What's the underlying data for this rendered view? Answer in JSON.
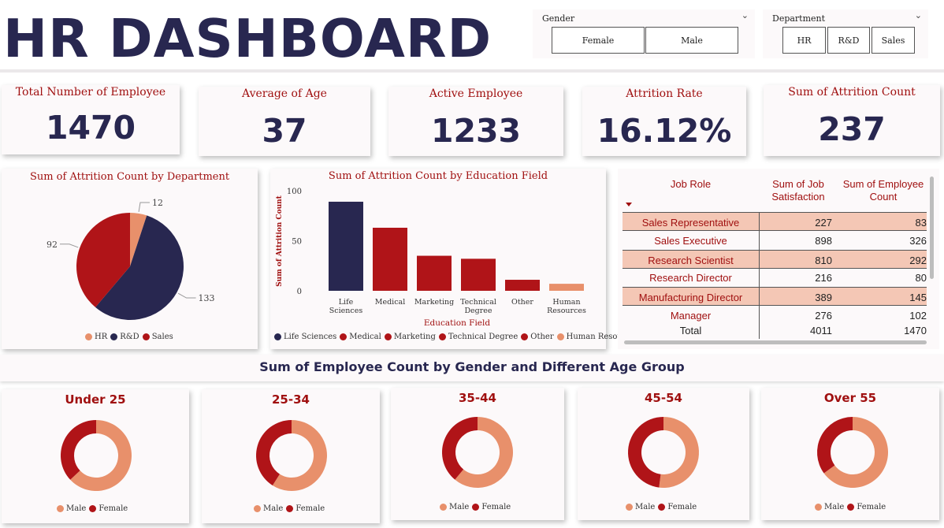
{
  "header": {
    "title": "HR DASHBOARD"
  },
  "slicers": {
    "gender": {
      "label": "Gender",
      "options": [
        "Female",
        "Male"
      ]
    },
    "department": {
      "label": "Department",
      "options": [
        "HR",
        "R&D",
        "Sales"
      ]
    }
  },
  "kpis": [
    {
      "label": "Total Number of Employee",
      "value": "1470"
    },
    {
      "label": "Average of Age",
      "value": "37"
    },
    {
      "label": "Active Employee",
      "value": "1233"
    },
    {
      "label": "Attrition Rate",
      "value": "16.12%"
    },
    {
      "label": "Sum of Attrition Count",
      "value": "237"
    }
  ],
  "colors": {
    "navy": "#282750",
    "red": "#b01418",
    "peach": "#e8906b",
    "table_band": "#f4c7b5",
    "title": "#282750",
    "accent_text": "#a01010"
  },
  "chart_data": [
    {
      "type": "pie",
      "title": "Sum of Attrition Count by Department",
      "categories": [
        "HR",
        "R&D",
        "Sales"
      ],
      "values": [
        12,
        133,
        92
      ],
      "colors": [
        "#e8906b",
        "#282750",
        "#b01418"
      ],
      "legend": "bottom"
    },
    {
      "type": "bar",
      "title": "Sum of Attrition Count by Education Field",
      "categories": [
        "Life Sciences",
        "Medical",
        "Marketing",
        "Technical Degree",
        "Other",
        "Human Resources"
      ],
      "tick_labels": [
        [
          "Life",
          "Sciences"
        ],
        [
          "Medical"
        ],
        [
          "Marketing"
        ],
        [
          "Technical",
          "Degree"
        ],
        [
          "Other"
        ],
        [
          "Human",
          "Resources"
        ]
      ],
      "legend_labels": [
        "Life Sciences",
        "Medical",
        "Marketing",
        "Technical Degree",
        "Other",
        "Human Resou..."
      ],
      "values": [
        89,
        63,
        35,
        32,
        11,
        7
      ],
      "colors": [
        "#282750",
        "#b01418",
        "#b01418",
        "#b01418",
        "#b01418",
        "#e8906b"
      ],
      "xlabel": "Education Field",
      "ylabel": "Sum of Attrition Count",
      "ylim": [
        0,
        100
      ],
      "yticks": [
        0,
        50,
        100
      ],
      "legend": "bottom"
    },
    {
      "type": "table",
      "columns": [
        "Job Role",
        "Sum of Job Satisfaction",
        "Sum of Employee Count"
      ],
      "column_lines": [
        [
          "Job Role"
        ],
        [
          "Sum of Job",
          "Satisfaction"
        ],
        [
          "Sum of Employee",
          "Count"
        ]
      ],
      "rows": [
        [
          "Sales Representative",
          "227",
          "83"
        ],
        [
          "Sales Executive",
          "898",
          "326"
        ],
        [
          "Research Scientist",
          "810",
          "292"
        ],
        [
          "Research Director",
          "216",
          "80"
        ],
        [
          "Manufacturing Director",
          "389",
          "145"
        ],
        [
          "Manager",
          "276",
          "102"
        ]
      ],
      "total": [
        "Total",
        "4011",
        "1470"
      ]
    },
    {
      "type": "pie",
      "subtype": "donut",
      "title": "Sum of Employee Count by Gender and Different Age Group",
      "groups": [
        {
          "title": "Under 25",
          "male_fraction": 0.63
        },
        {
          "title": "25-34",
          "male_fraction": 0.59
        },
        {
          "title": "35-44",
          "male_fraction": 0.61
        },
        {
          "title": "45-54",
          "male_fraction": 0.52
        },
        {
          "title": "Over 55",
          "male_fraction": 0.65
        }
      ],
      "series_labels": [
        "Male",
        "Female"
      ],
      "colors": [
        "#e8906b",
        "#b01418"
      ],
      "legend": "bottom"
    }
  ]
}
